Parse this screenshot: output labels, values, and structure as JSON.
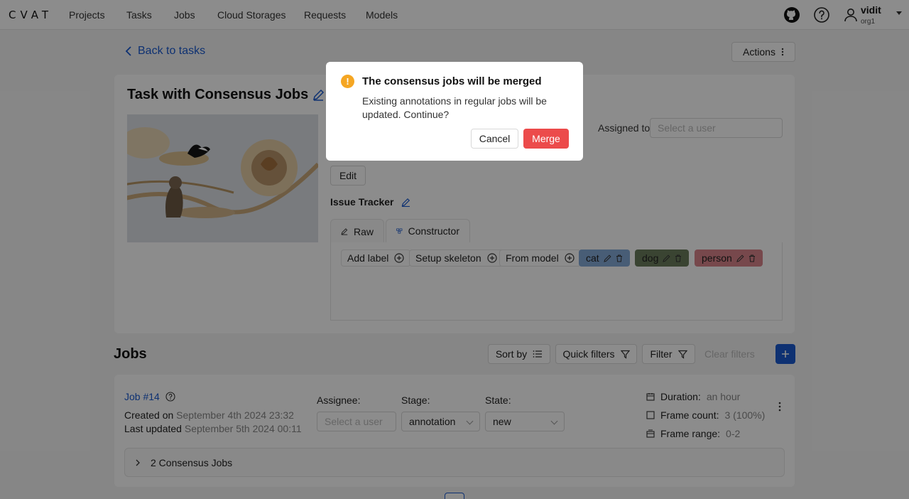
{
  "header": {
    "logo": "CVAT",
    "nav": [
      "Projects",
      "Tasks",
      "Jobs",
      "Cloud Storages",
      "Requests",
      "Models"
    ],
    "user": {
      "name": "vidit",
      "org": "org1"
    }
  },
  "page": {
    "back_label": "Back to tasks",
    "actions_label": "Actions"
  },
  "task": {
    "title": "Task with Consensus Jobs",
    "assigned_label": "Assigned to",
    "assignee_placeholder": "Select a user",
    "edit_label": "Edit",
    "issue_tracker_label": "Issue Tracker",
    "tabs": {
      "raw": "Raw",
      "constructor": "Constructor"
    },
    "label_buttons": {
      "add_label": "Add label",
      "setup_skeleton": "Setup skeleton",
      "from_model": "From model"
    },
    "labels": [
      {
        "name": "cat",
        "color": "#83a9d8"
      },
      {
        "name": "dog",
        "color": "#6b7d5c"
      },
      {
        "name": "person",
        "color": "#d9848a"
      }
    ]
  },
  "jobs": {
    "title": "Jobs",
    "sort_label": "Sort by",
    "quick_filters_label": "Quick filters",
    "filter_label": "Filter",
    "clear_filters_label": "Clear filters",
    "job": {
      "link": "Job #14",
      "created_prefix": "Created on",
      "created_value": "September 4th 2024 23:32",
      "updated_prefix": "Last updated",
      "updated_value": "September 5th 2024 00:11",
      "assignee_label": "Assignee:",
      "assignee_placeholder": "Select a user",
      "stage_label": "Stage:",
      "stage_value": "annotation",
      "state_label": "State:",
      "state_value": "new",
      "duration_label": "Duration:",
      "duration_value": "an hour",
      "frame_count_label": "Frame count:",
      "frame_count_value": "3 (100%)",
      "frame_range_label": "Frame range:",
      "frame_range_value": "0-2",
      "consensus_label": "2 Consensus Jobs"
    }
  },
  "modal": {
    "title": "The consensus jobs will be merged",
    "body": "Existing annotations in regular jobs will be updated. Continue?",
    "cancel_label": "Cancel",
    "merge_label": "Merge",
    "warn_color": "#f5a623",
    "merge_color": "#ec4b4b"
  }
}
